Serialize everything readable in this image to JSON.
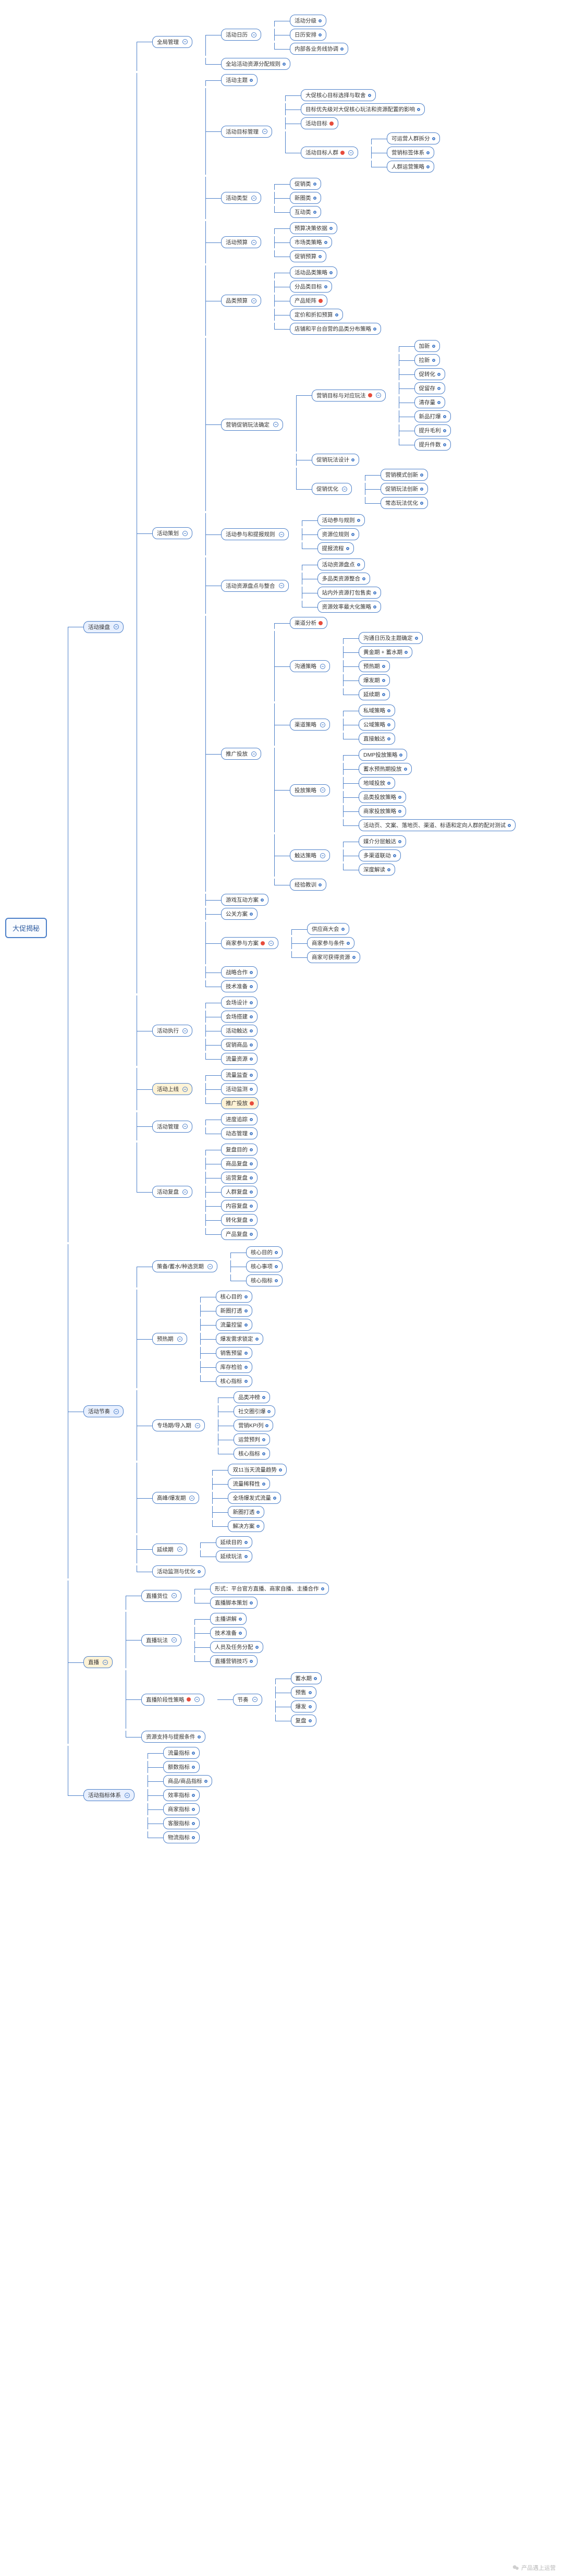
{
  "watermark": "产品遇上运营",
  "root": "大促揭秘",
  "tree": [
    {
      "label": "活动操盘",
      "hl": "b",
      "children": [
        {
          "label": "全局管理",
          "children": [
            {
              "label": "活动日历",
              "children": [
                {
                  "label": "活动分级",
                  "dot": "blue"
                },
                {
                  "label": "日历安排",
                  "dot": "blue"
                },
                {
                  "label": "内部各业务线协调",
                  "dot": "blue"
                }
              ]
            },
            {
              "label": "全站活动资源分配规则",
              "dot": "blue"
            }
          ]
        },
        {
          "label": "活动策划",
          "children": [
            {
              "label": "活动主题",
              "dot": "blue"
            },
            {
              "label": "活动目标管理",
              "children": [
                {
                  "label": "大促核心目标选择与取舍",
                  "dot": "blue"
                },
                {
                  "label": "目标优先级对大促核心玩法和资源配置的影响",
                  "dot": "blue"
                },
                {
                  "label": "活动目标",
                  "dot": "red"
                },
                {
                  "label": "活动目标人群",
                  "dot": "red",
                  "children": [
                    {
                      "label": "可运营人群拆分",
                      "dot": "blue"
                    },
                    {
                      "label": "营销标签体系",
                      "dot": "blue"
                    },
                    {
                      "label": "人群运营策略",
                      "dot": "blue"
                    }
                  ]
                }
              ]
            },
            {
              "label": "活动类型",
              "children": [
                {
                  "label": "促销类",
                  "dot": "blue"
                },
                {
                  "label": "新圈类",
                  "dot": "blue"
                },
                {
                  "label": "互动类",
                  "dot": "blue"
                }
              ]
            },
            {
              "label": "活动预算",
              "children": [
                {
                  "label": "预算决策依据",
                  "dot": "blue"
                },
                {
                  "label": "市场类策略",
                  "dot": "blue"
                },
                {
                  "label": "促销预算",
                  "dot": "blue"
                }
              ]
            },
            {
              "label": "品类预算",
              "children": [
                {
                  "label": "活动品类策略",
                  "dot": "blue"
                },
                {
                  "label": "分品类目标",
                  "dot": "blue"
                },
                {
                  "label": "产品矩阵",
                  "dot": "red"
                },
                {
                  "label": "定价和折扣预算",
                  "dot": "blue"
                },
                {
                  "label": "店铺和平台自营的品类分布策略",
                  "dot": "blue"
                }
              ]
            },
            {
              "label": "营销促销玩法确定",
              "children": [
                {
                  "label": "营销目标与对应玩法",
                  "dot": "red",
                  "children": [
                    {
                      "label": "加新",
                      "dot": "blue"
                    },
                    {
                      "label": "拉新",
                      "dot": "blue"
                    },
                    {
                      "label": "促转化",
                      "dot": "blue"
                    },
                    {
                      "label": "促留存",
                      "dot": "blue"
                    },
                    {
                      "label": "清存量",
                      "dot": "blue"
                    },
                    {
                      "label": "新品打爆",
                      "dot": "blue"
                    },
                    {
                      "label": "提升毛利",
                      "dot": "blue"
                    },
                    {
                      "label": "提升件数",
                      "dot": "blue"
                    }
                  ]
                },
                {
                  "label": "促销玩法设计",
                  "dot": "blue"
                },
                {
                  "label": "促销优化",
                  "children": [
                    {
                      "label": "营销模式创新",
                      "dot": "blue"
                    },
                    {
                      "label": "促销玩法创新",
                      "dot": "blue"
                    },
                    {
                      "label": "常态玩法优化",
                      "dot": "blue"
                    }
                  ]
                }
              ]
            },
            {
              "label": "活动参与和提报规则",
              "children": [
                {
                  "label": "活动参与规则",
                  "dot": "blue"
                },
                {
                  "label": "资源位规则",
                  "dot": "blue"
                },
                {
                  "label": "提报流程",
                  "dot": "blue"
                }
              ]
            },
            {
              "label": "活动资源盘点与整合",
              "children": [
                {
                  "label": "活动资源盘点",
                  "dot": "blue"
                },
                {
                  "label": "多品类资源整合",
                  "dot": "blue"
                },
                {
                  "label": "站内外资源打包售卖",
                  "dot": "blue"
                },
                {
                  "label": "资源效率最大化策略",
                  "dot": "blue"
                }
              ]
            },
            {
              "label": "推广投放",
              "children": [
                {
                  "label": "渠道分析",
                  "dot": "red"
                },
                {
                  "label": "沟通策略",
                  "children": [
                    {
                      "label": "沟通日历及主题确定",
                      "dot": "blue"
                    },
                    {
                      "label": "黄金期 + 蓄水期",
                      "dot": "blue"
                    },
                    {
                      "label": "预热期",
                      "dot": "blue"
                    },
                    {
                      "label": "爆发期",
                      "dot": "blue"
                    },
                    {
                      "label": "延续期",
                      "dot": "blue"
                    }
                  ]
                },
                {
                  "label": "渠道策略",
                  "children": [
                    {
                      "label": "私域策略",
                      "dot": "blue"
                    },
                    {
                      "label": "公域策略",
                      "dot": "blue"
                    },
                    {
                      "label": "直接触达",
                      "dot": "blue"
                    }
                  ]
                },
                {
                  "label": "投放策略",
                  "children": [
                    {
                      "label": "DMP投放策略",
                      "dot": "blue"
                    },
                    {
                      "label": "蓄水预热期投放",
                      "dot": "blue"
                    },
                    {
                      "label": "地域投放",
                      "dot": "blue"
                    },
                    {
                      "label": "品类投放策略",
                      "dot": "blue"
                    },
                    {
                      "label": "商家投放策略",
                      "dot": "blue"
                    },
                    {
                      "label": "活动页、文案、落地页、渠道、标语和定向人群的配对测试",
                      "dot": "blue"
                    }
                  ]
                },
                {
                  "label": "触达策略",
                  "children": [
                    {
                      "label": "媒介分层触达",
                      "dot": "blue"
                    },
                    {
                      "label": "多渠道联动",
                      "dot": "blue"
                    },
                    {
                      "label": "深度解读",
                      "dot": "blue"
                    }
                  ]
                },
                {
                  "label": "经验教训",
                  "dot": "blue"
                }
              ]
            },
            {
              "label": "游戏互动方案",
              "dot": "blue"
            },
            {
              "label": "公关方案",
              "dot": "blue"
            },
            {
              "label": "商家参与方案",
              "dot": "red",
              "children": [
                {
                  "label": "供应商大会",
                  "dot": "blue"
                },
                {
                  "label": "商家参与条件",
                  "dot": "blue"
                },
                {
                  "label": "商家可获得资源",
                  "dot": "blue"
                }
              ]
            },
            {
              "label": "战略合作",
              "dot": "blue"
            },
            {
              "label": "技术准备",
              "dot": "blue"
            }
          ]
        },
        {
          "label": "活动执行",
          "children": [
            {
              "label": "会场设计",
              "dot": "blue"
            },
            {
              "label": "会场搭建",
              "dot": "blue"
            },
            {
              "label": "活动触达",
              "dot": "blue"
            },
            {
              "label": "促销商品",
              "dot": "blue"
            },
            {
              "label": "流量资源",
              "dot": "blue"
            }
          ]
        },
        {
          "label": "活动上线",
          "hl": "y",
          "children": [
            {
              "label": "流量监查",
              "dot": "blue"
            },
            {
              "label": "活动监测",
              "dot": "blue"
            },
            {
              "label": "推广投放",
              "hl": "y",
              "dot": "red"
            }
          ]
        },
        {
          "label": "活动管理",
          "children": [
            {
              "label": "进度追踪",
              "dot": "blue"
            },
            {
              "label": "动态管理",
              "dot": "blue"
            }
          ]
        },
        {
          "label": "活动复盘",
          "children": [
            {
              "label": "复盘目的",
              "dot": "blue"
            },
            {
              "label": "商品复盘",
              "dot": "blue"
            },
            {
              "label": "运营复盘",
              "dot": "blue"
            },
            {
              "label": "人群复盘",
              "dot": "blue"
            },
            {
              "label": "内容复盘",
              "dot": "blue"
            },
            {
              "label": "转化复盘",
              "dot": "blue"
            },
            {
              "label": "产品复盘",
              "dot": "blue"
            }
          ]
        }
      ]
    },
    {
      "label": "活动节奏",
      "hl": "b",
      "children": [
        {
          "label": "策备/蓄水/种选货期",
          "children": [
            {
              "label": "核心目的",
              "dot": "blue"
            },
            {
              "label": "核心事项",
              "dot": "blue"
            },
            {
              "label": "核心指标",
              "dot": "blue"
            }
          ]
        },
        {
          "label": "预热期",
          "children": [
            {
              "label": "核心目的",
              "dot": "blue"
            },
            {
              "label": "新圈打透",
              "dot": "blue"
            },
            {
              "label": "流量控留",
              "dot": "blue"
            },
            {
              "label": "爆发需求锁定",
              "dot": "blue"
            },
            {
              "label": "销售预留",
              "dot": "blue"
            },
            {
              "label": "库存检验",
              "dot": "blue"
            },
            {
              "label": "核心指标",
              "dot": "blue"
            }
          ]
        },
        {
          "label": "专场期/导入期",
          "children": [
            {
              "label": "品类冲榜",
              "dot": "blue"
            },
            {
              "label": "社交圈引爆",
              "dot": "blue"
            },
            {
              "label": "营销KPI列",
              "dot": "blue"
            },
            {
              "label": "运营预判",
              "dot": "blue"
            },
            {
              "label": "核心指标",
              "dot": "blue"
            }
          ]
        },
        {
          "label": "高峰/爆发期",
          "children": [
            {
              "label": "双11当天流量趋势",
              "dot": "blue"
            },
            {
              "label": "流量稀释性",
              "dot": "blue"
            },
            {
              "label": "全场爆发式流量",
              "dot": "blue"
            },
            {
              "label": "新圈打透",
              "dot": "blue"
            },
            {
              "label": "解决方案",
              "dot": "blue"
            }
          ]
        },
        {
          "label": "延续期",
          "children": [
            {
              "label": "延续目的",
              "dot": "blue"
            },
            {
              "label": "延续玩法",
              "dot": "blue"
            }
          ]
        },
        {
          "label": "活动监测与优化",
          "dot": "blue"
        }
      ]
    },
    {
      "label": "直播",
      "hl": "y",
      "children": [
        {
          "label": "直播货位",
          "children": [
            {
              "label": "形式：平台官方直播、商家自播、主播合作",
              "dot": "blue"
            },
            {
              "label": "直播脚本策划",
              "dot": "blue"
            }
          ]
        },
        {
          "label": "直播玩法",
          "children": [
            {
              "label": "主播讲解",
              "dot": "blue"
            },
            {
              "label": "技术准备",
              "dot": "blue"
            },
            {
              "label": "人员及任务分配",
              "dot": "blue"
            },
            {
              "label": "直播营销技巧",
              "dot": "blue"
            }
          ]
        },
        {
          "label": "直播阶段性策略",
          "dot": "red",
          "children": [
            {
              "label": "节奏",
              "children": [
                {
                  "label": "蓄水期",
                  "dot": "blue"
                },
                {
                  "label": "预售",
                  "dot": "blue"
                },
                {
                  "label": "爆发",
                  "dot": "blue"
                },
                {
                  "label": "复盘",
                  "dot": "blue"
                }
              ]
            }
          ]
        },
        {
          "label": "资源支持与提报条件",
          "dot": "blue"
        }
      ]
    },
    {
      "label": "活动指标体系",
      "hl": "b",
      "children": [
        {
          "label": "流量指标",
          "dot": "blue"
        },
        {
          "label": "额数指标",
          "dot": "blue"
        },
        {
          "label": "商品/商品指标",
          "dot": "blue"
        },
        {
          "label": "效率指标",
          "dot": "blue"
        },
        {
          "label": "商家指标",
          "dot": "blue"
        },
        {
          "label": "客服指标",
          "dot": "blue"
        },
        {
          "label": "物流指标",
          "dot": "blue"
        }
      ]
    }
  ]
}
